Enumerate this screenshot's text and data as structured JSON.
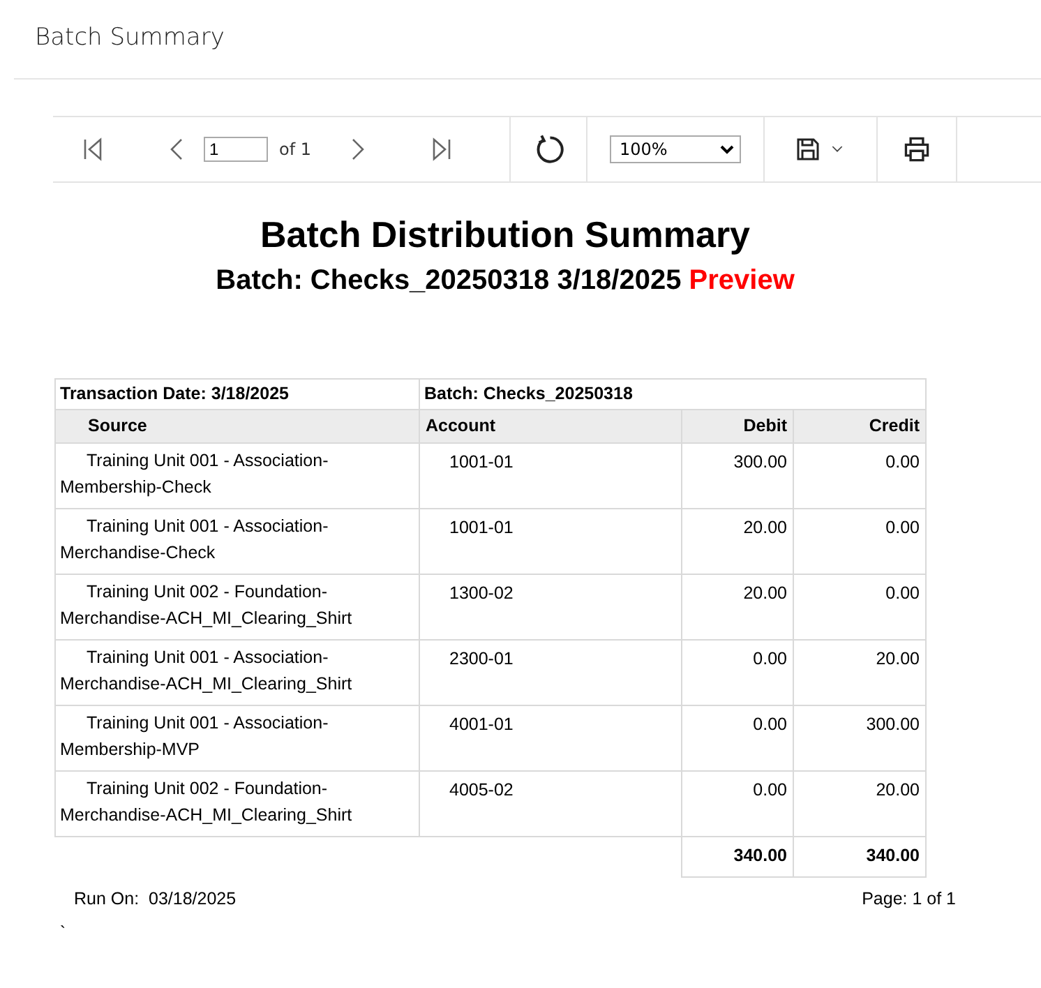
{
  "page_title": "Batch Summary",
  "toolbar": {
    "page_value": "1",
    "page_count": "of 1",
    "zoom": "100%"
  },
  "report": {
    "title": "Batch Distribution Summary",
    "subtitle": "Batch: Checks_20250318 3/18/2025",
    "status": "Preview"
  },
  "table": {
    "group_header": [
      "Transaction Date: 3/18/2025",
      "Batch: Checks_20250318"
    ],
    "columns": [
      "Source",
      "Account",
      "Debit",
      "Credit"
    ],
    "rows": [
      {
        "source": "Training Unit 001 - Association-Membership-Check",
        "account": "1001-01",
        "debit": "300.00",
        "credit": "0.00"
      },
      {
        "source": "Training Unit 001 - Association-Merchandise-Check",
        "account": "1001-01",
        "debit": "20.00",
        "credit": "0.00"
      },
      {
        "source": "Training Unit 002 - Foundation-Merchandise-ACH_MI_Clearing_Shirt",
        "account": "1300-02",
        "debit": "20.00",
        "credit": "0.00"
      },
      {
        "source": "Training Unit 001 - Association-Merchandise-ACH_MI_Clearing_Shirt",
        "account": "2300-01",
        "debit": "0.00",
        "credit": "20.00"
      },
      {
        "source": "Training Unit 001 - Association-Membership-MVP",
        "account": "4001-01",
        "debit": "0.00",
        "credit": "300.00"
      },
      {
        "source": "Training Unit 002 - Foundation-Merchandise-ACH_MI_Clearing_Shirt",
        "account": "4005-02",
        "debit": "0.00",
        "credit": "20.00"
      }
    ],
    "totals": {
      "debit": "340.00",
      "credit": "340.00"
    }
  },
  "footer": {
    "run_on": "Run On:  03/18/2025",
    "page": "Page: 1 of 1",
    "stray_mark": "`"
  }
}
